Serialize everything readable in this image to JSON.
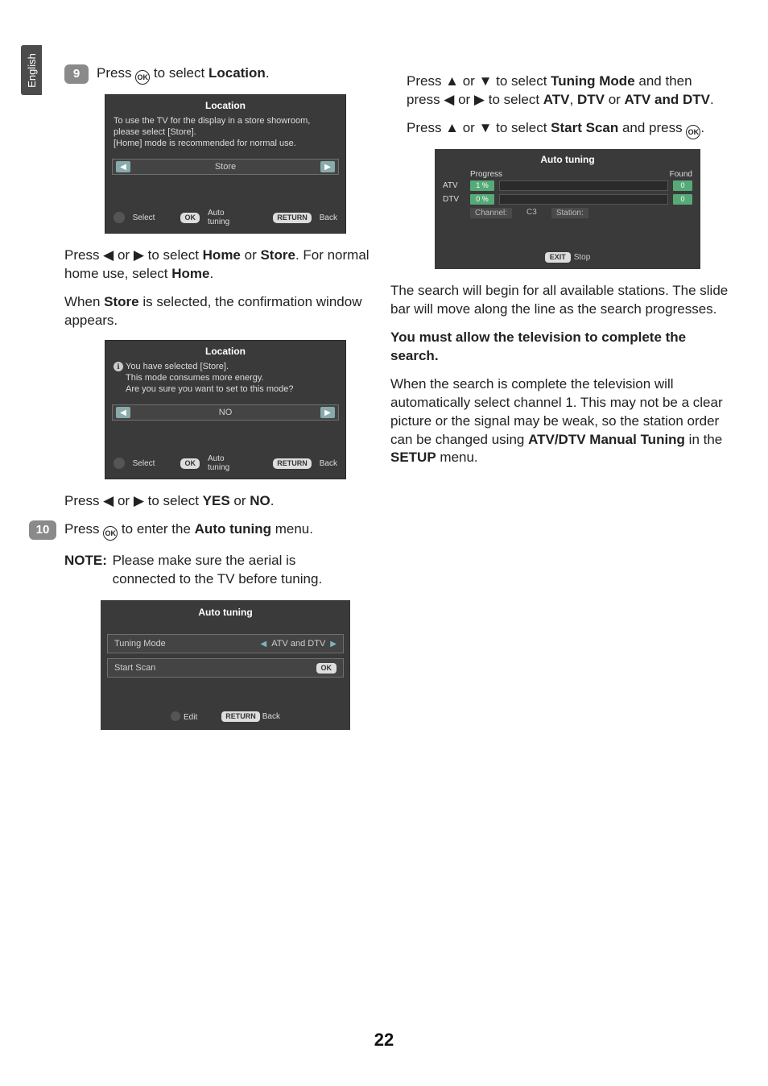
{
  "language_tab": "English",
  "page_number": "22",
  "steps": {
    "s9": {
      "num": "9",
      "text_before": "Press ",
      "text_after": " to select ",
      "bold": "Location",
      "tail": "."
    },
    "s10": {
      "num": "10",
      "text_before": "Press ",
      "text_after": " to enter the ",
      "bold": "Auto tuning",
      "tail": " menu."
    }
  },
  "left": {
    "p_home_store_1": "Press ◀ or ▶ to select ",
    "p_home_store_b1": "Home",
    "p_home_store_mid": " or ",
    "p_home_store_b2": "Store",
    "p_home_store_end": ". For normal home use, select ",
    "p_home_store_b3": "Home",
    "p_home_store_dot": ".",
    "p_store_conf_1": "When ",
    "p_store_conf_b": "Store",
    "p_store_conf_2": " is selected, the confirmation window appears.",
    "p_yesno_1": "Press ◀ or ▶ to select ",
    "p_yesno_b1": "YES",
    "p_yesno_mid": " or ",
    "p_yesno_b2": "NO",
    "p_yesno_dot": ".",
    "note_label": "NOTE:",
    "note_text": " Please make sure the aerial is connected to the TV before tuning."
  },
  "right": {
    "p_tm_1": "Press ▲ or ▼ to select ",
    "p_tm_b1": "Tuning Mode",
    "p_tm_2": " and then press ◀ or ▶ to select ",
    "p_tm_b2": "ATV",
    "p_tm_3": ", ",
    "p_tm_b3": "DTV",
    "p_tm_4": " or ",
    "p_tm_b4": "ATV and DTV",
    "p_tm_dot": ".",
    "p_ss_1": "Press ▲ or ▼ to select ",
    "p_ss_b": "Start Scan",
    "p_ss_2": " and press ",
    "p_ss_dot": ".",
    "p_search": "The search will begin for all available stations. The slide bar will move along the line as the search progresses.",
    "p_must": "You must allow the television to complete the search.",
    "p_complete_1": "When the search is complete the television will automatically select channel 1. This may not be a clear picture or the signal may be weak, so the station order can be changed using ",
    "p_complete_b1": "ATV/DTV Manual Tuning",
    "p_complete_2": " in the ",
    "p_complete_b2": "SETUP",
    "p_complete_3": " menu."
  },
  "osd_location1": {
    "title": "Location",
    "desc1": "To use the TV for the display in a store showroom, please select [Store].",
    "desc2": "[Home] mode is recommended for normal use.",
    "value": "Store",
    "footer": {
      "select": "Select",
      "okpill": "OK",
      "ok": "Auto tuning",
      "retpill": "RETURN",
      "ret": "Back"
    }
  },
  "osd_location2": {
    "title": "Location",
    "desc1": "You have selected [Store].",
    "desc2": "This mode consumes more energy.",
    "desc3": "Are you sure you want to set to this mode?",
    "value": "NO",
    "footer": {
      "select": "Select",
      "okpill": "OK",
      "ok": "Auto tuning",
      "retpill": "RETURN",
      "ret": "Back"
    }
  },
  "osd_at_menu": {
    "title": "Auto tuning",
    "row1": {
      "name": "Tuning Mode",
      "value": "ATV and DTV"
    },
    "row2": {
      "name": "Start Scan",
      "ok": "OK"
    },
    "footer": {
      "edit": "Edit",
      "retpill": "RETURN",
      "ret": "Back"
    }
  },
  "osd_at_prog": {
    "title": "Auto tuning",
    "hdr_progress": "Progress",
    "hdr_found": "Found",
    "rows": [
      {
        "label": "ATV",
        "pct": "1   %",
        "found": "0"
      },
      {
        "label": "DTV",
        "pct": "0   %",
        "found": "0"
      }
    ],
    "info": {
      "channel_l": "Channel:",
      "channel_v": "C3",
      "station_l": "Station:"
    },
    "footer": {
      "pill": "EXIT",
      "label": "Stop"
    }
  },
  "glyphs": {
    "ok": "OK",
    "info": "ℹ",
    "left": "◀",
    "right": "▶"
  }
}
